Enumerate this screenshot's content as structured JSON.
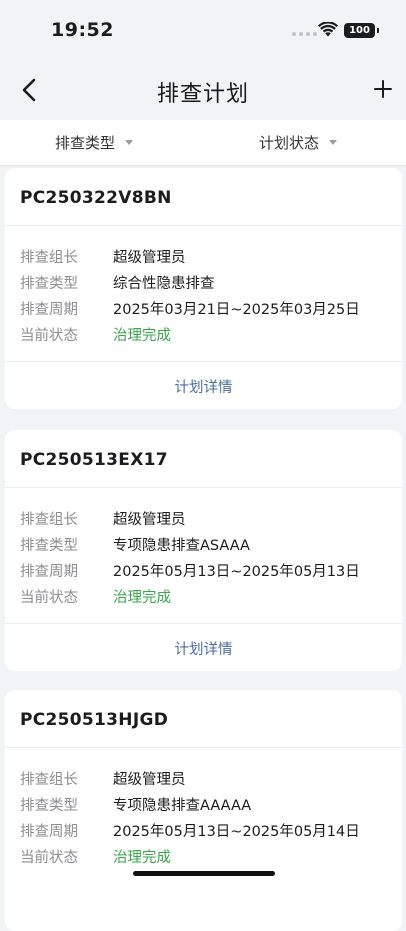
{
  "status_bar": {
    "time": "19:52",
    "battery": "100"
  },
  "nav": {
    "title": "排查计划"
  },
  "filters": {
    "type_label": "排查类型",
    "status_label": "计划状态"
  },
  "labels": {
    "leader": "排查组长",
    "type": "排查类型",
    "period": "排查周期",
    "state": "当前状态",
    "detail": "计划详情"
  },
  "plans": [
    {
      "code": "PC250322V8BN",
      "leader": "超级管理员",
      "type": "综合性隐患排查",
      "period": "2025年03月21日~2025年03月25日",
      "state": "治理完成"
    },
    {
      "code": "PC250513EX17",
      "leader": "超级管理员",
      "type": "专项隐患排查ASAAA",
      "period": "2025年05月13日~2025年05月13日",
      "state": "治理完成"
    },
    {
      "code": "PC250513HJGD",
      "leader": "超级管理员",
      "type": "专项隐患排查AAAAA",
      "period": "2025年05月13日~2025年05月14日",
      "state": "治理完成"
    }
  ],
  "colors": {
    "state_done": "#3aa64a",
    "link": "#4a6ea8",
    "background": "#f2f3f5"
  }
}
